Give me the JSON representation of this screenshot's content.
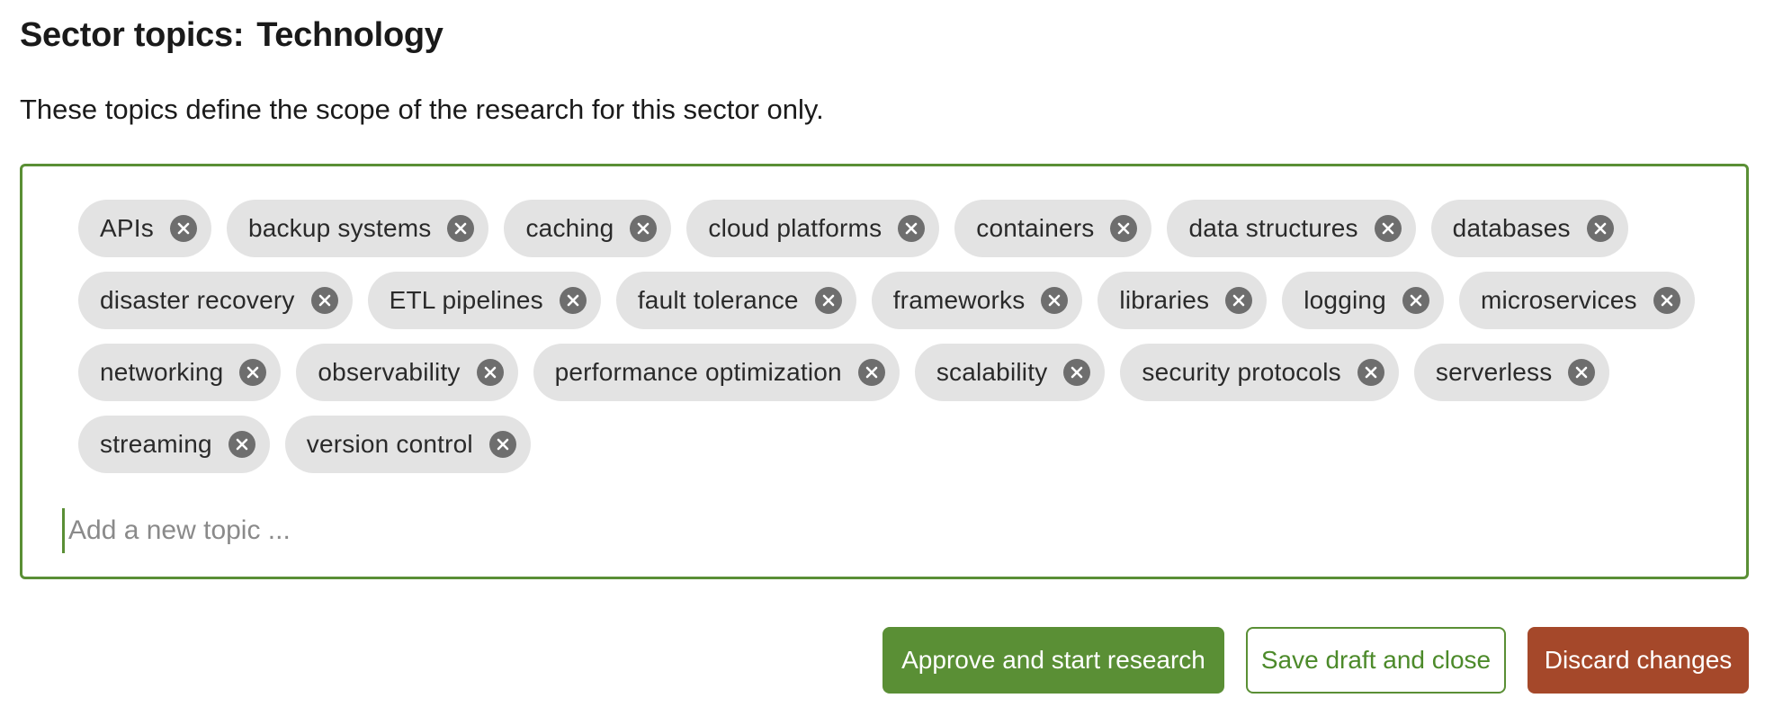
{
  "header": {
    "title_label": "Sector topics:",
    "sector_name": "Technology"
  },
  "description": "These topics define the scope of the research for this sector only.",
  "topics": [
    "APIs",
    "backup systems",
    "caching",
    "cloud platforms",
    "containers",
    "data structures",
    "databases",
    "disaster recovery",
    "ETL pipelines",
    "fault tolerance",
    "frameworks",
    "libraries",
    "logging",
    "microservices",
    "networking",
    "observability",
    "performance optimization",
    "scalability",
    "security protocols",
    "serverless",
    "streaming",
    "version control"
  ],
  "chip_remove_icon": "close-circle-icon",
  "new_topic_input": {
    "value": "",
    "placeholder": "Add a new topic ..."
  },
  "actions": {
    "approve_label": "Approve and start research",
    "save_draft_label": "Save draft and close",
    "discard_label": "Discard changes"
  },
  "colors": {
    "accent_green": "#5a8f35",
    "danger_red": "#a5482a",
    "chip_background": "#e3e3e3",
    "chip_remove_icon": "#6e6e6e"
  }
}
